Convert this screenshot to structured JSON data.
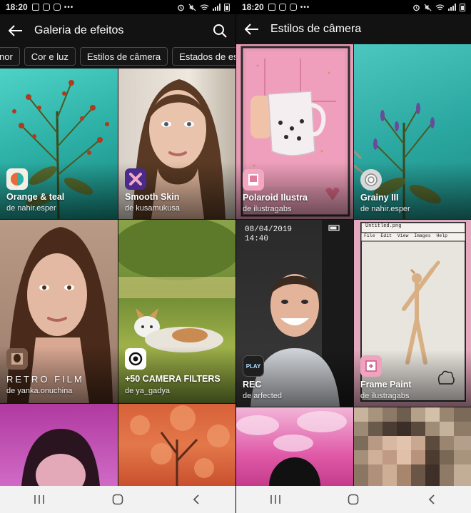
{
  "status_bar": {
    "time": "18:20",
    "left_icons": [
      "notification-icon",
      "instagram-icon",
      "instagram-icon",
      "more-dots-icon"
    ],
    "right_icons": [
      "alarm-icon",
      "mute-icon",
      "wifi-icon",
      "signal-icon",
      "battery-icon"
    ]
  },
  "left_screen": {
    "title": "Galeria de efeitos",
    "tabs": [
      "nor",
      "Cor e luz",
      "Estilos de câmera",
      "Estados de espírit"
    ],
    "effects": [
      {
        "name": "Orange & teal",
        "author": "de nahir.esper",
        "icon": "orange-teal-icon"
      },
      {
        "name": "Smooth Skin",
        "author": "de kusamukusa",
        "icon": "smooth-skin-icon"
      },
      {
        "name": "RETRO FILM",
        "author": "de yanka.onuchina",
        "icon": "retro-film-icon"
      },
      {
        "name": "+50 CAMERA FILTERS",
        "author": "de ya_gadya",
        "icon": "camera-filters-icon"
      }
    ]
  },
  "right_screen": {
    "title": "Estilos de câmera",
    "effects": [
      {
        "name": "Polaroid Ilustra",
        "author": "de ilustragabs",
        "icon": "polaroid-icon"
      },
      {
        "name": "Grainy III",
        "author": "de nahir.esper",
        "icon": "grainy-icon"
      },
      {
        "name": "REC",
        "author": "de arfected",
        "icon": "rec-play-icon",
        "overlay_date": "08/04/2019",
        "overlay_time": "14:40"
      },
      {
        "name": "Frame Paint",
        "author": "de ilustragabs",
        "icon": "frame-paint-icon",
        "overlay_window_title": "Untitled.png",
        "overlay_menu": "File  Edit  View  Images  Help"
      }
    ]
  },
  "colors": {
    "background": "#121212",
    "nav_bar": "#f2f2f2",
    "tab_border": "#4a4a4a",
    "teal": "#2fb7b0",
    "pink": "#e58aa6"
  }
}
